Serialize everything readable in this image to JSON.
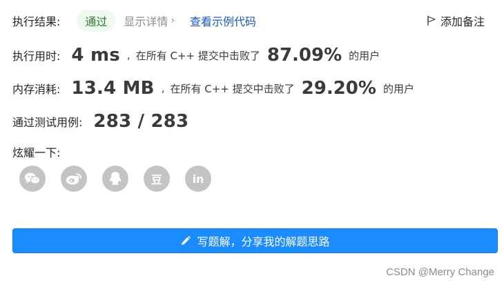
{
  "result": {
    "label": "执行结果:",
    "status": "通过",
    "detail_label": "显示详情",
    "example_label": "查看示例代码",
    "note_label": "添加备注"
  },
  "runtime": {
    "label": "执行用时:",
    "value": "4 ms",
    "sep": ",",
    "text": "在所有 C++ 提交中击败了",
    "percent": "87.09%",
    "suffix": "的用户"
  },
  "memory": {
    "label": "内存消耗:",
    "value": "13.4 MB",
    "sep": ",",
    "text": "在所有 C++ 提交中击败了",
    "percent": "29.20%",
    "suffix": "的用户"
  },
  "tests": {
    "label": "通过测试用例:",
    "value": "283 / 283"
  },
  "share": {
    "label": "炫耀一下:",
    "icons": [
      "wechat-icon",
      "weibo-icon",
      "qq-icon",
      "douban-icon",
      "linkedin-icon"
    ],
    "douban_glyph": "豆",
    "linkedin_glyph": "in"
  },
  "primary_button": {
    "label": "写题解，分享我的解题思路"
  },
  "watermark": "CSDN @Merry Change",
  "colors": {
    "accent": "#1a8cff",
    "status_bg": "#f0f9f0",
    "status_text": "#2d7a32",
    "link": "#1a5ab8",
    "icon_bg": "#c4c4c4"
  }
}
